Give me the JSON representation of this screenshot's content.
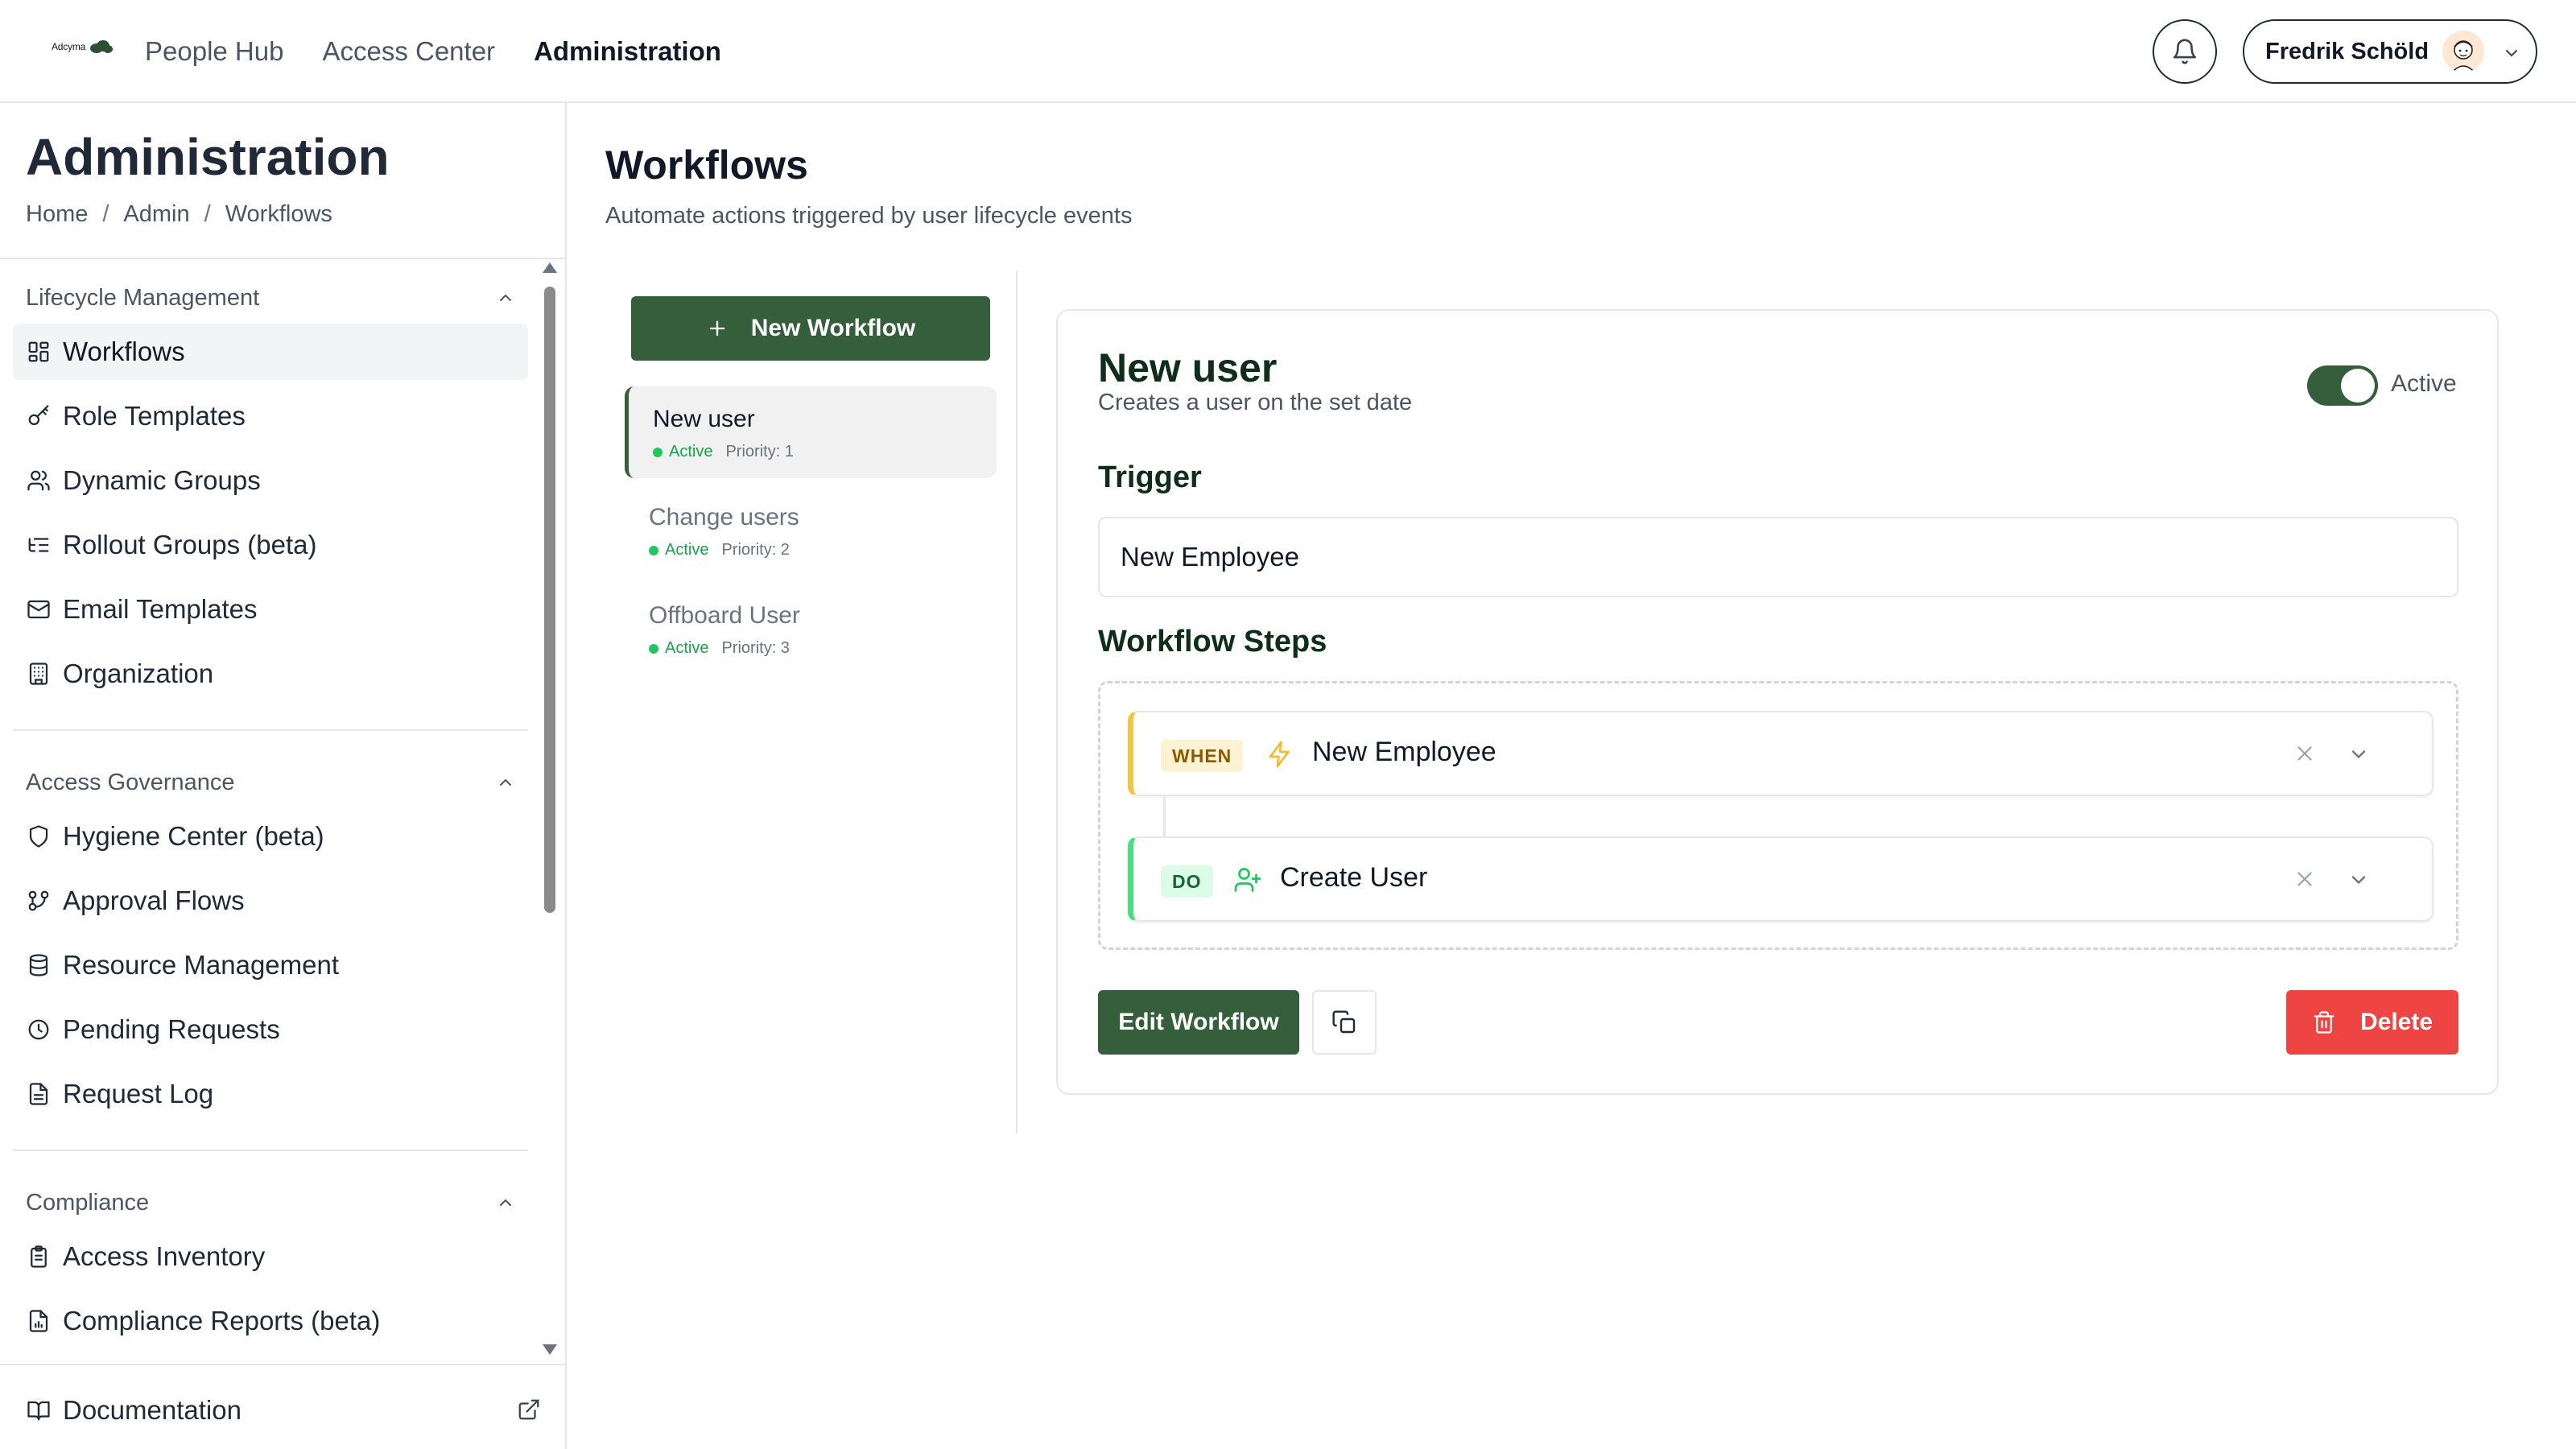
{
  "brand": {
    "logo_text": "Adcyma"
  },
  "topnav": [
    {
      "label": "People Hub"
    },
    {
      "label": "Access Center"
    },
    {
      "label": "Administration"
    }
  ],
  "user": {
    "name": "Fredrik Schöld"
  },
  "sidebar": {
    "title": "Administration",
    "breadcrumb": [
      "Home",
      "Admin",
      "Workflows"
    ],
    "sections": [
      {
        "label": "Lifecycle Management",
        "items": [
          {
            "label": "Workflows",
            "icon": "layout-grid-icon"
          },
          {
            "label": "Role Templates",
            "icon": "key-icon"
          },
          {
            "label": "Dynamic Groups",
            "icon": "users-icon"
          },
          {
            "label": "Rollout Groups (beta)",
            "icon": "list-tree-icon"
          },
          {
            "label": "Email Templates",
            "icon": "mail-icon"
          },
          {
            "label": "Organization",
            "icon": "building-icon"
          }
        ]
      },
      {
        "label": "Access Governance",
        "items": [
          {
            "label": "Hygiene Center (beta)",
            "icon": "shield-icon"
          },
          {
            "label": "Approval Flows",
            "icon": "git-branch-icon"
          },
          {
            "label": "Resource Management",
            "icon": "database-icon"
          },
          {
            "label": "Pending Requests",
            "icon": "clock-icon"
          },
          {
            "label": "Request Log",
            "icon": "file-text-icon"
          }
        ]
      },
      {
        "label": "Compliance",
        "items": [
          {
            "label": "Access Inventory",
            "icon": "clipboard-icon"
          },
          {
            "label": "Compliance Reports (beta)",
            "icon": "file-chart-icon"
          }
        ]
      }
    ],
    "documentation": {
      "label": "Documentation"
    }
  },
  "main": {
    "title": "Workflows",
    "subtitle": "Automate actions triggered by user lifecycle events",
    "new_workflow_label": "New Workflow",
    "workflows": [
      {
        "name": "New user",
        "status": "Active",
        "priority": "Priority: 1"
      },
      {
        "name": "Change users",
        "status": "Active",
        "priority": "Priority: 2"
      },
      {
        "name": "Offboard User",
        "status": "Active",
        "priority": "Priority: 3"
      }
    ]
  },
  "detail": {
    "title": "New user",
    "description": "Creates a user on the set date",
    "active_label": "Active",
    "active": true,
    "trigger_label": "Trigger",
    "trigger_value": "New Employee",
    "steps_label": "Workflow Steps",
    "steps": [
      {
        "badge": "WHEN",
        "icon": "zap-icon",
        "label": "New Employee"
      },
      {
        "badge": "DO",
        "icon": "user-plus-icon",
        "label": "Create User"
      }
    ],
    "edit_label": "Edit Workflow",
    "delete_label": "Delete"
  },
  "colors": {
    "brand_green": "#355e3b",
    "danger": "#ef4444",
    "when_accent": "#f5c542",
    "do_accent": "#4ade80",
    "status_green": "#22c55e"
  }
}
